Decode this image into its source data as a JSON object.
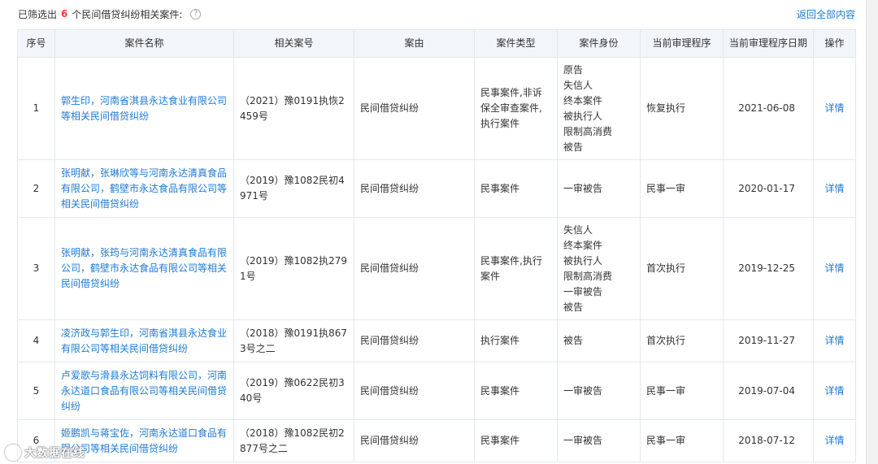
{
  "summary": {
    "prefix": "已筛选出",
    "count": "6",
    "suffix": "个民间借贷纠纷相关案件:",
    "help_icon": "question-circle-icon"
  },
  "back_link": "返回全部内容",
  "columns": [
    "序号",
    "案件名称",
    "相关案号",
    "案由",
    "案件类型",
    "案件身份",
    "当前审理程序",
    "当前审理程序日期",
    "操作"
  ],
  "rows": [
    {
      "idx": "1",
      "name": "郭生印，河南省淇县永达食业有限公司等相关民间借贷纠纷",
      "case_no": "（2021）豫0191执恢2459号",
      "cause": "民间借贷纠纷",
      "type": "民事案件,非诉保全审查案件,执行案件",
      "roles": [
        "原告",
        "失信人",
        "终本案件",
        "被执行人",
        "限制高消费",
        "被告"
      ],
      "procedure": "恢复执行",
      "date": "2021-06-08",
      "op": "详情"
    },
    {
      "idx": "2",
      "name": "张明献，张琳欣等与河南永达清真食品有限公司，鹤壁市永达食品有限公司等相关民间借贷纠纷",
      "case_no": "（2019）豫1082民初4971号",
      "cause": "民间借贷纠纷",
      "type": "民事案件",
      "roles": [
        "一审被告"
      ],
      "procedure": "民事一审",
      "date": "2020-01-17",
      "op": "详情"
    },
    {
      "idx": "3",
      "name": "张明献，张筠与河南永达清真食品有限公司，鹤壁市永达食品有限公司等相关民间借贷纠纷",
      "case_no": "（2019）豫1082执2791号",
      "cause": "民间借贷纠纷",
      "type": "民事案件,执行案件",
      "roles": [
        "失信人",
        "终本案件",
        "被执行人",
        "限制高消费",
        "一审被告",
        "被告"
      ],
      "procedure": "首次执行",
      "date": "2019-12-25",
      "op": "详情"
    },
    {
      "idx": "4",
      "name": "凌济政与郭生印，河南省淇县永达食业有限公司等相关民间借贷纠纷",
      "case_no": "（2018）豫0191执8673号之二",
      "cause": "民间借贷纠纷",
      "type": "执行案件",
      "roles": [
        "被告"
      ],
      "procedure": "首次执行",
      "date": "2019-11-27",
      "op": "详情"
    },
    {
      "idx": "5",
      "name": "卢爱歌与滑县永达饲料有限公司，河南永达道口食品有限公司等相关民间借贷纠纷",
      "case_no": "（2019）豫0622民初340号",
      "cause": "民间借贷纠纷",
      "type": "民事案件",
      "roles": [
        "一审被告"
      ],
      "procedure": "民事一审",
      "date": "2019-07-04",
      "op": "详情"
    },
    {
      "idx": "6",
      "name": "姬鹏凯与蒋宝佐，河南永达道口食品有限公司等相关民间借贷纠纷",
      "case_no": "（2018）豫1082民初2877号之二",
      "cause": "民间借贷纠纷",
      "type": "民事案件",
      "roles": [
        "一审被告"
      ],
      "procedure": "民事一审",
      "date": "2018-07-12",
      "op": "详情"
    }
  ],
  "watermark": "大数据在线",
  "colors": {
    "link": "#1e7ad6",
    "count": "#ff3b30",
    "header_bg": "#f2f5f9",
    "border": "#e4e8ee"
  }
}
